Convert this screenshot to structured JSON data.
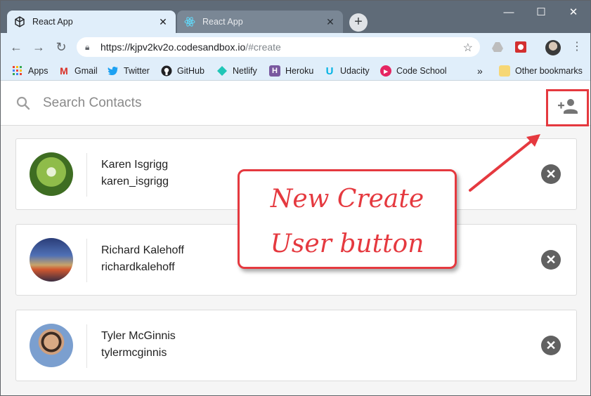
{
  "browser": {
    "tabs": [
      {
        "title": "React App",
        "active": true
      },
      {
        "title": "React App",
        "active": false
      }
    ],
    "url": {
      "host": "https://kjpv2kv2o.codesandbox.io",
      "path": "/#create"
    },
    "bookmarks": [
      {
        "label": "Apps",
        "icon": "apps-grid-icon"
      },
      {
        "label": "Gmail",
        "icon": "gmail-icon"
      },
      {
        "label": "Twitter",
        "icon": "twitter-icon"
      },
      {
        "label": "GitHub",
        "icon": "github-icon"
      },
      {
        "label": "Netlify",
        "icon": "netlify-icon"
      },
      {
        "label": "Heroku",
        "icon": "heroku-icon"
      },
      {
        "label": "Udacity",
        "icon": "udacity-icon"
      },
      {
        "label": "Code School",
        "icon": "code-school-icon"
      }
    ],
    "overflow_label": "»",
    "other_bookmarks": "Other bookmarks"
  },
  "app": {
    "search": {
      "placeholder": "Search Contacts",
      "value": ""
    },
    "add_button_icon": "person-add-icon",
    "contacts": [
      {
        "name": "Karen Isgrigg",
        "handle": "karen_isgrigg"
      },
      {
        "name": "Richard Kalehoff",
        "handle": "richardkalehoff"
      },
      {
        "name": "Tyler McGinnis",
        "handle": "tylermcginnis"
      }
    ]
  },
  "annotation": {
    "line1": "New Create",
    "line2": "User button",
    "color": "#e5393f"
  }
}
